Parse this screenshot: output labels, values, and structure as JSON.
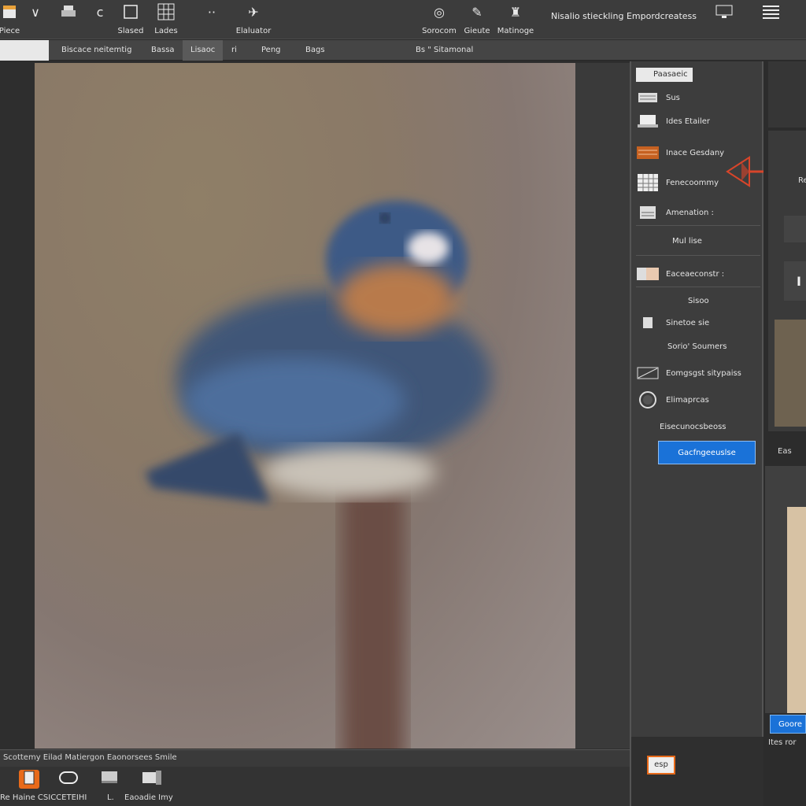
{
  "colors": {
    "accent": "#1a72d8",
    "highlight": "#e86a1a",
    "arrow": "#d8452a"
  },
  "toolbar": {
    "items": [
      {
        "icon": "document-icon",
        "label": "Piece"
      },
      {
        "icon": "brush-icon",
        "label": ""
      },
      {
        "icon": "printer-icon",
        "label": ""
      },
      {
        "icon": "curve-icon",
        "label": ""
      },
      {
        "icon": "square-icon",
        "label": "Slased"
      },
      {
        "icon": "grid-icon",
        "label": "Lades"
      },
      {
        "icon": "dots-icon",
        "label": ""
      },
      {
        "icon": "tools-icon",
        "label": "Elaluator"
      },
      {
        "icon": "camera-icon",
        "label": "Sorocom"
      },
      {
        "icon": "pen-icon",
        "label": "Gieute"
      },
      {
        "icon": "stamp-icon",
        "label": "Matinoge"
      }
    ],
    "right_text": "Nisalio stieckling Empordcreatess",
    "monitor_icon": "monitor-icon",
    "list_icon": "list-icon"
  },
  "options_bar": {
    "items": [
      "Biscace neitemtig",
      "Bassa",
      "Lisaoc",
      "ri",
      "Peng",
      "Bags",
      "Bs \" Sitamonal"
    ]
  },
  "status_bar": {
    "text": "Scottemy Eilad Matiergon Eaonorsees Smile"
  },
  "bottom_bar": {
    "buttons": [
      {
        "icon": "square-outline-icon"
      },
      {
        "icon": "circle-icon"
      },
      {
        "icon": "monitor-icon"
      },
      {
        "icon": "window-icon"
      }
    ],
    "labels": [
      "Re Haine CSICCETEIHI",
      "L.",
      "Eaoadie Imy"
    ]
  },
  "panel": {
    "tab_label": "Paasaeic",
    "rows": [
      {
        "icon": "keyboard-icon",
        "label": "Sus"
      },
      {
        "icon": "laptop-icon",
        "label": "Ides Etailer"
      },
      {
        "icon": "layers-icon",
        "label": "Inace Gesdany"
      },
      {
        "icon": "table-icon",
        "label": "Fenecoommy"
      },
      {
        "icon": "chart-icon",
        "label": "Amenation :"
      },
      {
        "icon": "",
        "label": "Mul lise"
      },
      {
        "icon": "palette-icon",
        "label": "Eaceaeconstr :"
      },
      {
        "icon": "",
        "label": "Sisoo"
      },
      {
        "icon": "file-icon",
        "label": "Sinetoe sie"
      },
      {
        "icon": "",
        "label": "Sorio' Soumers"
      },
      {
        "icon": "gradient-icon",
        "label": "Eomgsgst sitypaiss"
      },
      {
        "icon": "circle-icon",
        "label": "Elimaprcas"
      },
      {
        "icon": "",
        "label": "Eisecunocsbeoss"
      }
    ],
    "button_label": "Gacfngeeuslse",
    "footer_badge": "esp"
  },
  "strip": {
    "label_1": "Ree",
    "label_2": "I",
    "label_3": "Eas",
    "button_label": "Goore",
    "footer_text": "Ites ror"
  }
}
